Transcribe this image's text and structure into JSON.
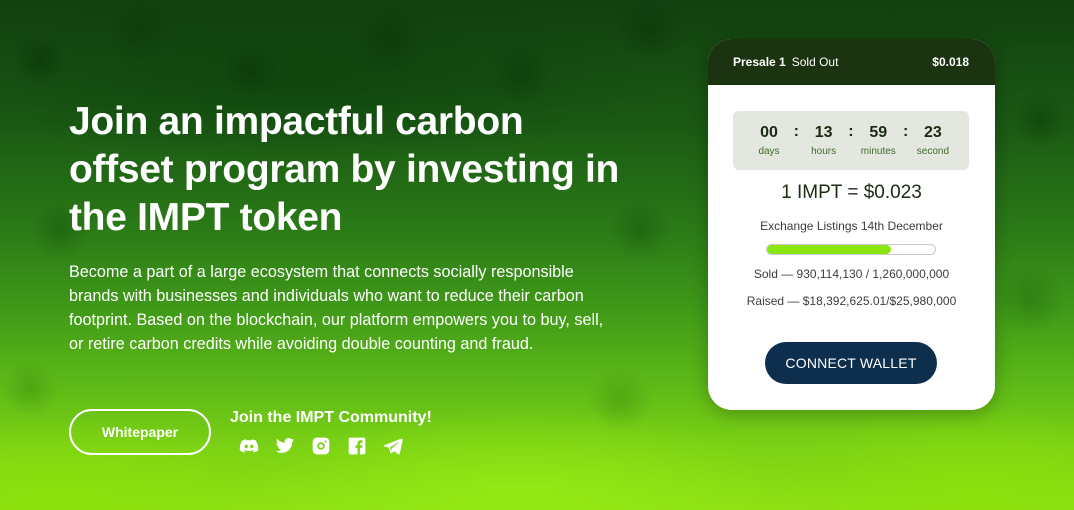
{
  "hero": {
    "title": "Join an impactful carbon offset program by investing in the IMPT token",
    "description": "Become a part of a large ecosystem that connects socially responsible brands with businesses and individuals who want to reduce their carbon footprint. Based on the blockchain, our platform empowers you to buy, sell, or retire carbon credits while avoiding double counting and fraud.",
    "whitepaper_label": "Whitepaper"
  },
  "community": {
    "title": "Join the IMPT Community!",
    "icons": [
      "discord-icon",
      "twitter-icon",
      "instagram-icon",
      "facebook-icon",
      "telegram-icon"
    ]
  },
  "presale": {
    "label": "Presale 1",
    "status": "Sold Out",
    "price": "$0.018",
    "countdown": [
      {
        "value": "00",
        "label": "days"
      },
      {
        "value": "13",
        "label": "hours"
      },
      {
        "value": "59",
        "label": "minutes"
      },
      {
        "value": "23",
        "label": "second"
      }
    ],
    "separator": ":",
    "rate": "1 IMPT = $0.023",
    "listing": "Exchange Listings 14th December",
    "progress_percent": 73.8,
    "sold": "Sold — 930,114,130 / 1,260,000,000",
    "raised": "Raised — $18,392,625.01/$25,980,000",
    "connect_label": "CONNECT WALLET"
  },
  "colors": {
    "card_header": "#1b3311",
    "progress_fill": "#8ae60f",
    "connect_button": "#0e2e4d"
  }
}
